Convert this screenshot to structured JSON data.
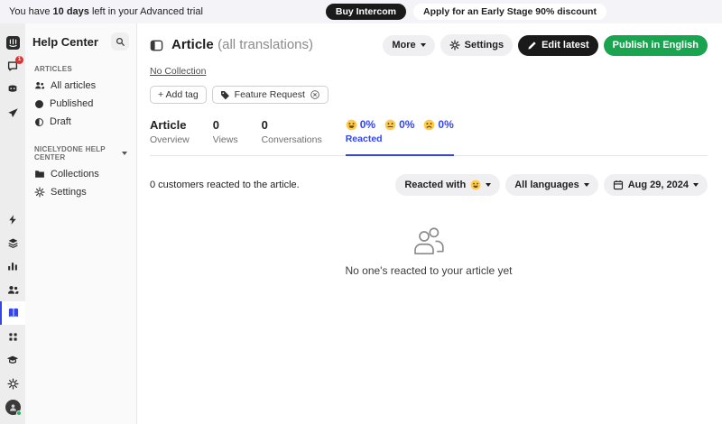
{
  "banner": {
    "text_prefix": "You have",
    "days": "10 days",
    "text_suffix": "left in your Advanced trial",
    "buy_label": "Buy Intercom",
    "discount_label": "Apply for an Early Stage 90% discount"
  },
  "rail": {
    "inbox_badge": "1"
  },
  "help_panel": {
    "title": "Help Center",
    "sections": [
      {
        "label": "ARTICLES",
        "items": [
          {
            "label": "All articles"
          },
          {
            "label": "Published"
          },
          {
            "label": "Draft"
          }
        ]
      },
      {
        "label": "NICELYDONE HELP CENTER",
        "items": [
          {
            "label": "Collections"
          },
          {
            "label": "Settings"
          }
        ]
      }
    ]
  },
  "header": {
    "title": "Article",
    "subtitle": "(all translations)",
    "more_label": "More",
    "settings_label": "Settings",
    "edit_label": "Edit latest",
    "publish_label": "Publish in English",
    "collection_link": "No Collection",
    "add_tag_label": "+ Add tag",
    "tag_label": "Feature Request"
  },
  "tabs": [
    {
      "value": "Article",
      "label": "Overview"
    },
    {
      "value": "0",
      "label": "Views"
    },
    {
      "value": "0",
      "label": "Conversations"
    },
    {
      "label": "Reacted",
      "reactions": [
        {
          "emoji": "happy-face-icon",
          "value": "0%"
        },
        {
          "emoji": "neutral-face-icon",
          "value": "0%"
        },
        {
          "emoji": "sad-face-icon",
          "value": "0%"
        }
      ]
    }
  ],
  "filters": {
    "summary": "0 customers reacted to the article.",
    "reacted_with_label": "Reacted with",
    "languages_label": "All languages",
    "date_label": "Aug 29, 2024"
  },
  "empty_state": {
    "message": "No one's reacted to your article yet"
  },
  "colors": {
    "accent_blue": "#3345ec",
    "publish_green": "#1ba450",
    "badge_red": "#e0312f",
    "dark_button": "#1a1a1a",
    "banner_bg": "#f4f3f8",
    "rail_bg": "#ededed",
    "panel_bg": "#fafafa"
  }
}
